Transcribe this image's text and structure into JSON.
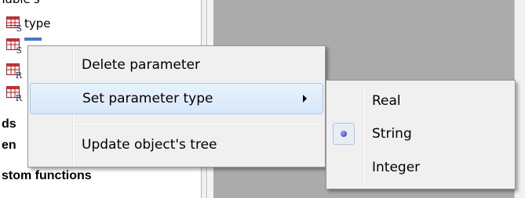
{
  "tree": {
    "clipped_top_text": "Table's",
    "items": [
      {
        "label": "type",
        "icon": "table-s-icon",
        "letter": "S",
        "bold": false
      },
      {
        "label": "",
        "icon": "table-s-icon",
        "letter": "S",
        "bold": false
      },
      {
        "label": "",
        "icon": "table-r-icon",
        "letter": "R",
        "bold": false
      },
      {
        "label": "",
        "icon": "table-r-icon",
        "letter": "R",
        "bold": false
      },
      {
        "label": "ds",
        "bold": true
      },
      {
        "label": "en",
        "bold": true
      },
      {
        "label": "stom functions",
        "bold": true
      },
      {
        "label": "",
        "bold": true
      }
    ]
  },
  "context_menu": {
    "items": [
      {
        "label": "Delete parameter"
      },
      {
        "label": "Set parameter type",
        "has_submenu": true
      },
      {
        "label": "Update object's tree"
      }
    ]
  },
  "submenu": {
    "items": [
      {
        "label": "Real",
        "selected": false
      },
      {
        "label": "String",
        "selected": true
      },
      {
        "label": "Integer",
        "selected": false
      }
    ]
  },
  "colors": {
    "workspace": "#ababab",
    "menu_background": "#f0f0f0",
    "hover_highlight": "#dceaf9",
    "selection_blue": "#3a7bd5"
  }
}
